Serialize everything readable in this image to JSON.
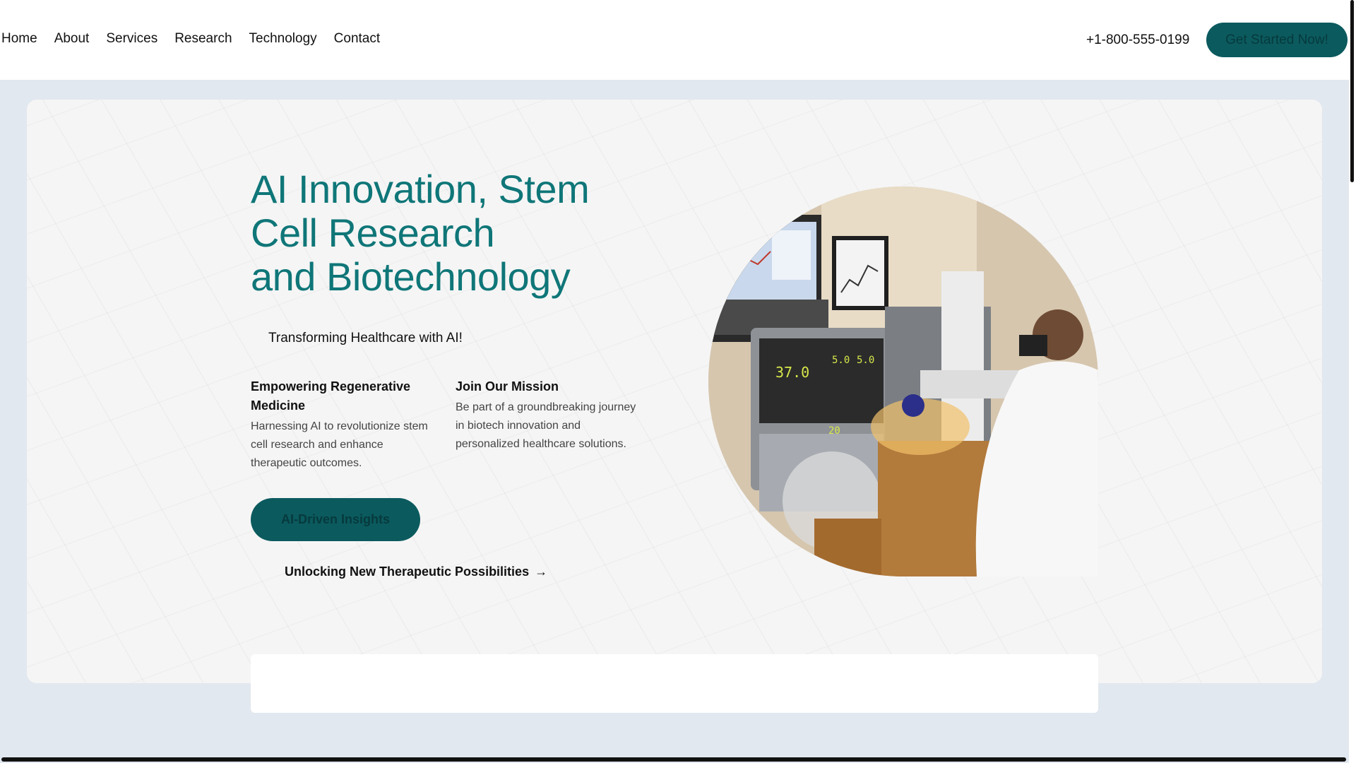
{
  "header": {
    "nav": [
      "Home",
      "About",
      "Services",
      "Research",
      "Technology",
      "Contact"
    ],
    "phone": "+1-800-555-0199",
    "cta_label": "Get Started Now!"
  },
  "hero": {
    "title": "AI Innovation, Stem\nCell Research\nand Biotechnology",
    "subtitle": "Transforming Healthcare with AI!",
    "features": [
      {
        "title": "Empowering Regenerative Medicine",
        "text": "Harnessing AI to revolutionize stem cell research and enhance therapeutic outcomes."
      },
      {
        "title": "Join Our Mission",
        "text": "Be part of a groundbreaking journey in biotech innovation and personalized healthcare solutions."
      }
    ],
    "primary_cta": "AI-Driven Insights",
    "secondary_link": "Unlocking New Therapeutic Possibilities",
    "secondary_link_icon": "arrow-right-icon",
    "arrow_glyph": "→"
  },
  "colors": {
    "accent": "#0f7678",
    "button": "#0b5a5e",
    "page_bg": "#e2e8ef",
    "card_bg": "#f5f5f5"
  }
}
